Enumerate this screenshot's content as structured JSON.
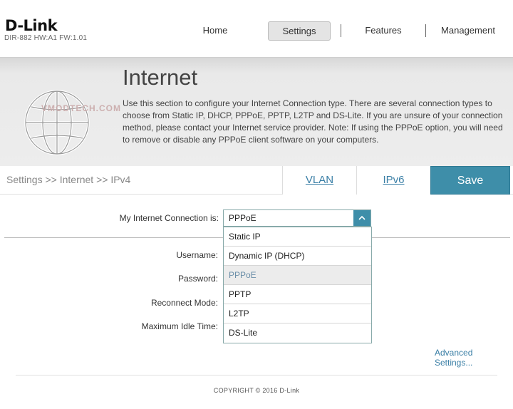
{
  "header": {
    "logo": "D-Link",
    "model": "DIR-882 HW:A1 FW:1.01",
    "nav": {
      "home": "Home",
      "settings": "Settings",
      "features": "Features",
      "management": "Management"
    }
  },
  "banner": {
    "title": "Internet",
    "description": "Use this section to configure your Internet Connection type. There are several connection types to choose from Static IP, DHCP, PPPoE, PPTP, L2TP and DS-Lite. If you are unsure of your connection method, please contact your Internet service provider. Note: If using the PPPoE option, you will need to remove or disable any PPPoE client software on your computers.",
    "watermark": "VMODTECH.COM"
  },
  "tabbar": {
    "breadcrumb": "Settings >> Internet >> IPv4",
    "vlan": "VLAN",
    "ipv6": "IPv6",
    "save": "Save"
  },
  "form": {
    "connection_label": "My Internet Connection is:",
    "connection_value": "PPPoE",
    "username_label": "Username:",
    "password_label": "Password:",
    "reconnect_label": "Reconnect Mode:",
    "idle_label": "Maximum Idle Time:",
    "options": [
      "Static IP",
      "Dynamic IP (DHCP)",
      "PPPoE",
      "PPTP",
      "L2TP",
      "DS-Lite"
    ],
    "selected_option": "PPPoE",
    "advanced_link": "Advanced Settings..."
  },
  "footer": {
    "copyright": "COPYRIGHT © 2016 D-Link"
  },
  "colors": {
    "accent": "#3e8ea9",
    "link": "#3a7fa6"
  }
}
